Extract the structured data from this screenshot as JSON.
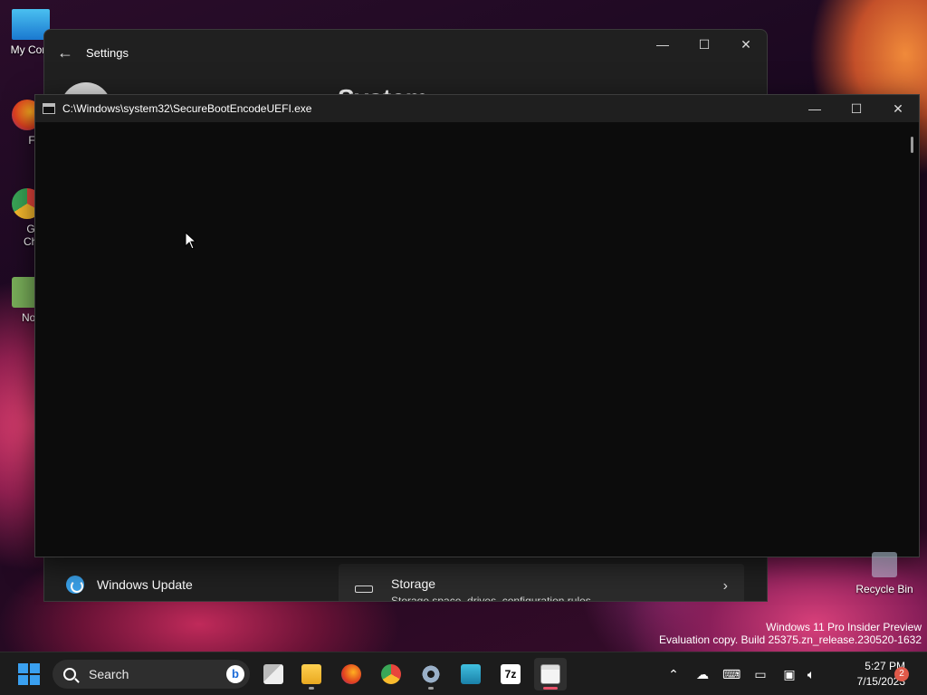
{
  "desktop": {
    "icons": [
      {
        "label": "My Com"
      },
      {
        "label": "Fire"
      },
      {
        "label": "Goo"
      },
      {
        "label": "Chro"
      },
      {
        "label": "Notep"
      }
    ],
    "recycle_bin": "Recycle Bin"
  },
  "settings": {
    "title": "Settings",
    "heading": "System",
    "nav_item": "Windows Update",
    "storage_title": "Storage",
    "storage_sub": "Storage space, drives, configuration rules"
  },
  "console": {
    "title": "C:\\Windows\\system32\\SecureBootEncodeUEFI.exe"
  },
  "controls": {
    "minimize": "—",
    "maximize": "☐",
    "close": "✕",
    "back": "←"
  },
  "watermark": {
    "line1": "Windows 11 Pro Insider Preview",
    "line2": "Evaluation copy. Build 25375.zn_release.230520-1632"
  },
  "taskbar": {
    "search_label": "Search",
    "bing": "b",
    "clock_time": "5:27 PM",
    "clock_date": "7/15/2023",
    "notification_count": "2",
    "apps": [
      {
        "name": "task-view"
      },
      {
        "name": "file-explorer"
      },
      {
        "name": "firefox"
      },
      {
        "name": "chrome"
      },
      {
        "name": "settings"
      },
      {
        "name": "keyboard-app"
      },
      {
        "name": "7zip",
        "label": "7z"
      },
      {
        "name": "console",
        "active": true
      }
    ]
  },
  "colors": {
    "accent": "#3aa0f0",
    "console_bg": "#0c0c0c",
    "window_bg": "#202020",
    "taskbar_bg": "#1c1c1c",
    "active_indicator": "#e8526a"
  }
}
